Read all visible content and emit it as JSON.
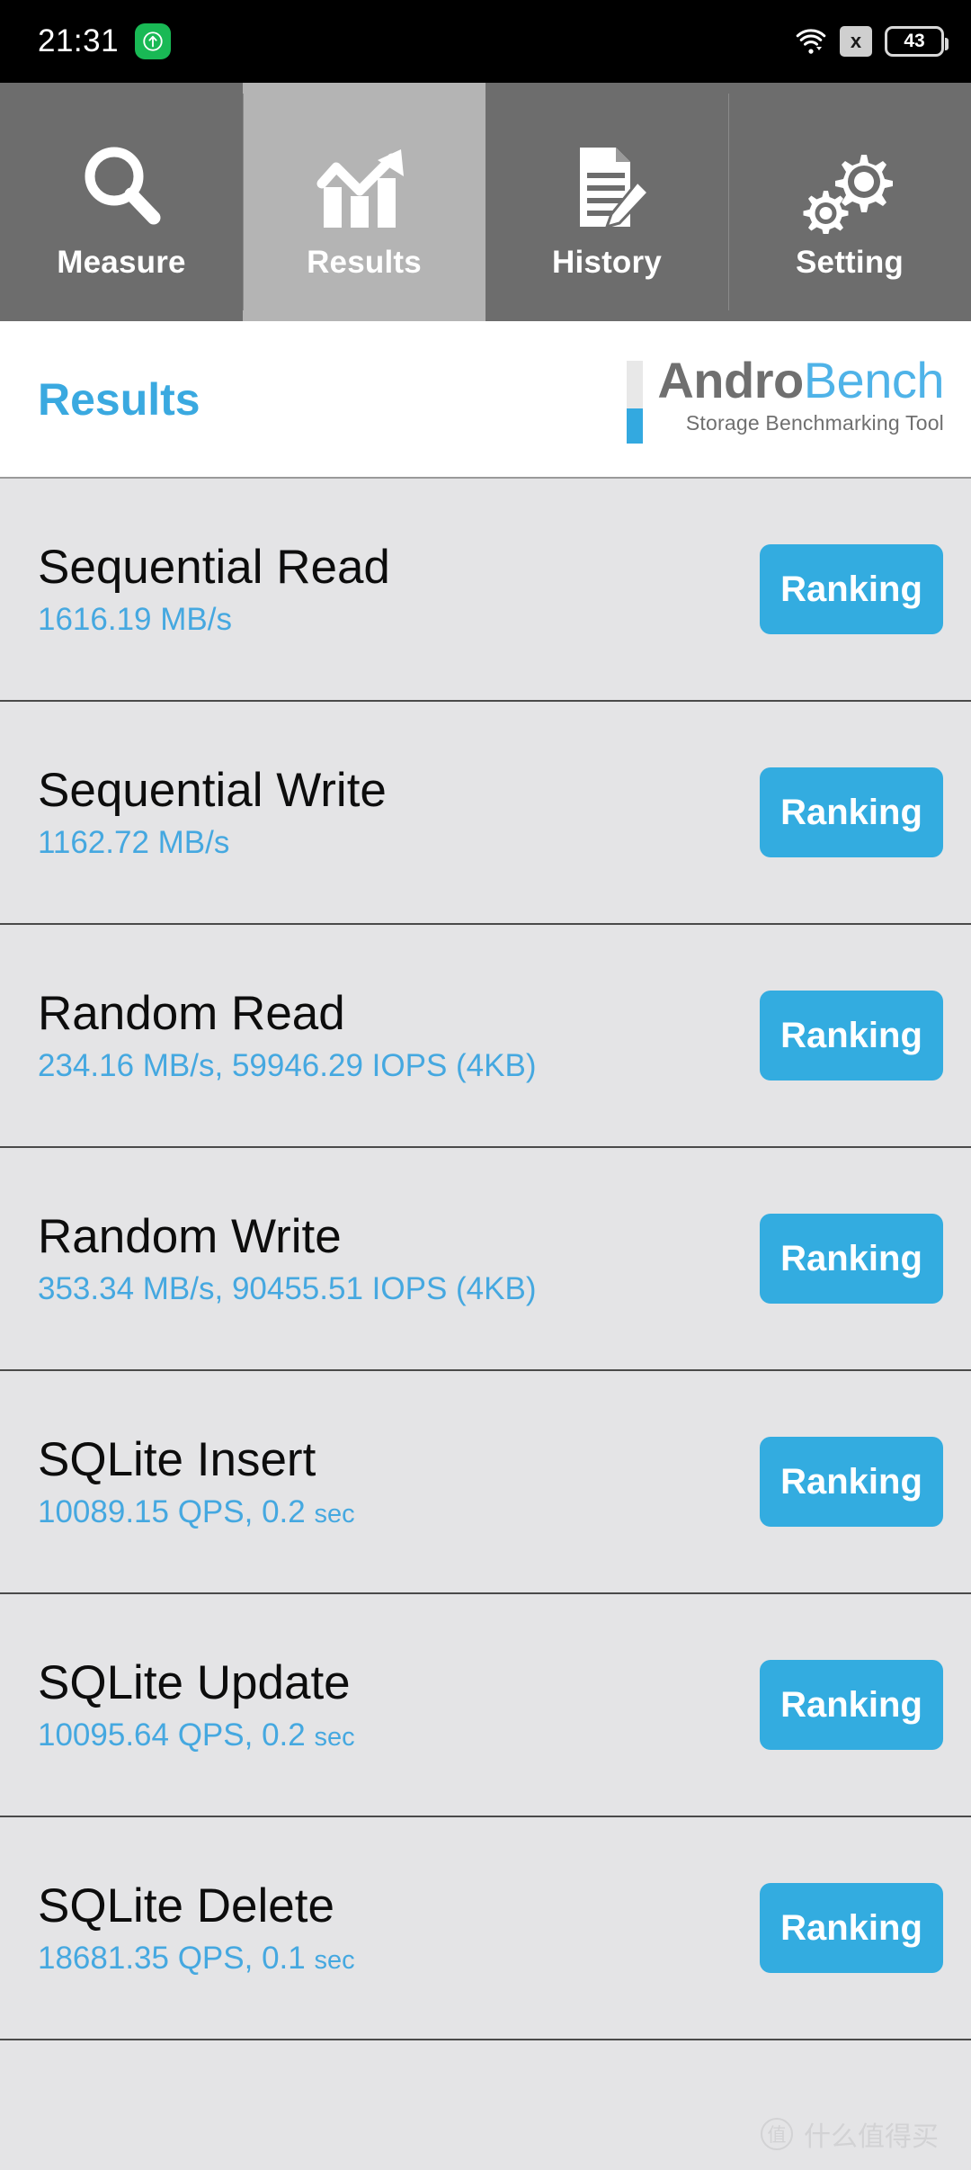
{
  "statusbar": {
    "clock": "21:31",
    "upload_badge_icon": "upload-arrow-icon",
    "wifi_icon": "wifi-icon",
    "x_icon": "x-icon",
    "x_label": "x",
    "battery_level": "43"
  },
  "tabs": [
    {
      "label": "Measure",
      "icon": "magnifier-icon",
      "active": false
    },
    {
      "label": "Results",
      "icon": "bar-chart-trend-icon",
      "active": true
    },
    {
      "label": "History",
      "icon": "document-pencil-icon",
      "active": false
    },
    {
      "label": "Setting",
      "icon": "gears-icon",
      "active": false
    }
  ],
  "header": {
    "page_title": "Results",
    "logo_primary": "Andro",
    "logo_secondary": "Bench",
    "logo_tagline": "Storage Benchmarking Tool"
  },
  "results": [
    {
      "title": "Sequential Read",
      "value": "1616.19 MB/s",
      "value_suffix": "",
      "button": "Ranking"
    },
    {
      "title": "Sequential Write",
      "value": "1162.72 MB/s",
      "value_suffix": "",
      "button": "Ranking"
    },
    {
      "title": "Random Read",
      "value": "234.16 MB/s, 59946.29 IOPS (4KB)",
      "value_suffix": "",
      "button": "Ranking"
    },
    {
      "title": "Random Write",
      "value": "353.34 MB/s, 90455.51 IOPS (4KB)",
      "value_suffix": "",
      "button": "Ranking"
    },
    {
      "title": "SQLite Insert",
      "value": "10089.15 QPS, 0.2 ",
      "value_suffix": "sec",
      "button": "Ranking"
    },
    {
      "title": "SQLite Update",
      "value": "10095.64 QPS, 0.2 ",
      "value_suffix": "sec",
      "button": "Ranking"
    },
    {
      "title": "SQLite Delete",
      "value": "18681.35 QPS, 0.1 ",
      "value_suffix": "sec",
      "button": "Ranking"
    }
  ],
  "watermark": {
    "mark": "值",
    "text": "什么值得买"
  },
  "colors": {
    "accent_blue": "#33ace0",
    "value_blue": "#45a8e0",
    "title_blue": "#3aa9e0",
    "row_bg": "#e4e4e6",
    "tab_bg": "#6d6d6d",
    "tab_active_bg": "#b4b4b4",
    "statusbar_bg": "#000000",
    "badge_green": "#19b955"
  }
}
